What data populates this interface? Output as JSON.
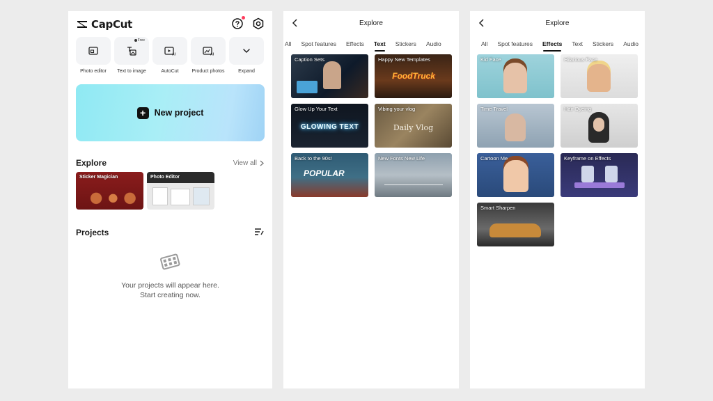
{
  "home": {
    "brand": "CapCut",
    "tools": [
      {
        "label": "Photo editor",
        "icon": "photo-editor-icon",
        "tag": ""
      },
      {
        "label": "Text to image",
        "icon": "text-to-image-icon",
        "tag": "Free"
      },
      {
        "label": "AutoCut",
        "icon": "autocut-icon",
        "tag": ""
      },
      {
        "label": "Product photos",
        "icon": "product-photos-icon",
        "tag": ""
      },
      {
        "label": "Expand",
        "icon": "chevron-down-icon",
        "tag": ""
      }
    ],
    "new_project_label": "New project",
    "explore_title": "Explore",
    "view_all": "View all",
    "explore_cards": [
      {
        "label": "Sticker Magician"
      },
      {
        "label": "Photo Editor"
      }
    ],
    "projects_title": "Projects",
    "empty_line1": "Your projects will appear here.",
    "empty_line2": "Start creating now."
  },
  "explore_text": {
    "title": "Explore",
    "tabs": [
      "All",
      "Spot features",
      "Effects",
      "Text",
      "Stickers",
      "Audio"
    ],
    "active_tab": "Text",
    "cards": [
      {
        "label": "Caption Sets",
        "overlay": ""
      },
      {
        "label": "Happy New Templates",
        "overlay": "FoodTruck"
      },
      {
        "label": "Glow Up Your Text",
        "overlay": "GLOWING TEXT"
      },
      {
        "label": "Vibing your vlog",
        "overlay": "Daily Vlog"
      },
      {
        "label": "Back to the 90s!",
        "overlay": "POPULAR"
      },
      {
        "label": "New Fonts New Life",
        "overlay": ""
      }
    ]
  },
  "explore_effects": {
    "title": "Explore",
    "tabs": [
      "All",
      "Spot features",
      "Effects",
      "Text",
      "Stickers",
      "Audio"
    ],
    "active_tab": "Effects",
    "cards": [
      {
        "label": "Kid Face"
      },
      {
        "label": "Hilarious Face"
      },
      {
        "label": "Time Travel"
      },
      {
        "label": "Hair Dyeing"
      },
      {
        "label": "Cartoon Me"
      },
      {
        "label": "Keyframe on Effects"
      },
      {
        "label": "Smart Sharpen"
      }
    ]
  },
  "colors": {
    "accent_new_project": "#a9eef6",
    "notification_dot": "#ff3b5c",
    "text_primary": "#111111"
  }
}
